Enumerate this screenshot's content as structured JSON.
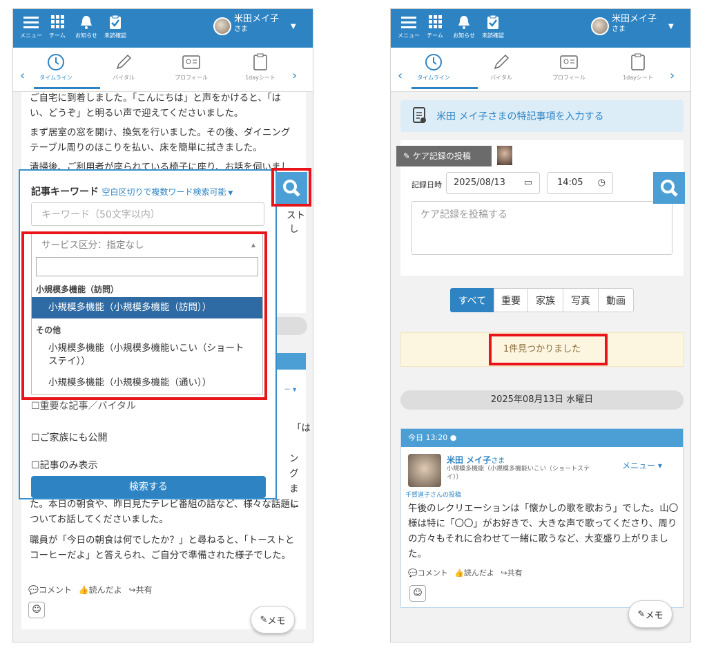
{
  "header": {
    "menu_label": "メニュー",
    "team_label": "チーム",
    "notice_label": "お知らせ",
    "unconfirmed_label": "未読確認",
    "user_name": "米田メイ子",
    "user_suffix": "さま"
  },
  "tabs": {
    "timeline": "タイムライン",
    "vital": "バイタル",
    "profile": "プロフィール",
    "oneday": "1dayシート"
  },
  "left": {
    "article_top": "ご自宅に到着しました。「こんにちは」と声をかけると、「はい、どうぞ」と明るい声で迎えてくださいました。",
    "article_p2": "まず居室の窓を開け、換気を行いました。その後、ダイニングテーブル周りのほこりを払い、床を簡単に拭きました。",
    "article_p3": "清掃後、ご利用者が座られている椅子に座り、お話を伺いまし",
    "bg_frag1": "話題",
    "bg_frag2": "スト",
    "bg_frag3": "し",
    "bg_frag4": "「は",
    "bg_frag5": "ング",
    "bg_frag6": "まし",
    "article_p4": "た。本日の朝食や、昨日見たテレビ番組の話など、様々な話題についてお話してくださいました。",
    "article_p5": "職員が「今日の朝食は何でしたか？」と尋ねると、「トーストとコーヒーだよ」と答えられ、ご自分で準備された様子でした。",
    "comment": "コメント",
    "read": "読んだよ",
    "share": "共有",
    "memo": "メモ",
    "search_panel": {
      "title": "記事キーワード",
      "hint": "空白区切りで複数ワード検索可能",
      "keyword_placeholder": "キーワード（50文字以内）",
      "service_select": "サービス区分：指定なし",
      "group1": "小規模多機能（訪問）",
      "opt1": "小規模多機能（小規模多機能（訪問））",
      "group2": "その他",
      "opt2": "小規模多機能（小規模多機能いこい（ショートステイ））",
      "opt3": "小規模多機能（小規模多機能（通い））",
      "chk_important": "重要な記事／バイタル",
      "chk_family": "ご家族にも公開",
      "chk_only": "記事のみ表示",
      "search_button": "検索する"
    }
  },
  "right": {
    "special_notes": "米田 メイ子さまの特記事項を入力する",
    "post_tab": "ケア記録の投稿",
    "date_label": "記録日時",
    "date_value": "2025/08/13",
    "time_value": "14:05",
    "post_placeholder": "ケア記録を投稿する",
    "filters": [
      "すべて",
      "重要",
      "家族",
      "写真",
      "動画"
    ],
    "found": "1件見つかりました",
    "date_heading": "2025年08月13日 水曜日",
    "post_time": "今日 13:20",
    "post_name": "米田 メイ子",
    "post_name_suffix": "さま",
    "post_service": "小規模多機能（小規模多機能いこい（ショートステイ））",
    "post_menu": "メニュー",
    "post_author": "千賀道子さんの投稿",
    "post_body": "午後のレクリエーションは「懐かしの歌を歌おう」でした。山〇様は特に「〇〇」がお好きで、大きな声で歌ってくださり、周りの方々もそれに合わせて一緒に歌うなど、大変盛り上がりました。",
    "comment": "コメント",
    "read": "読んだよ",
    "share": "共有",
    "memo": "メモ"
  },
  "colors": {
    "brand": "#2e84c3",
    "highlight": "#e8141a",
    "found_bg": "#fcf6e1",
    "notes_bg": "#dcedf8"
  }
}
